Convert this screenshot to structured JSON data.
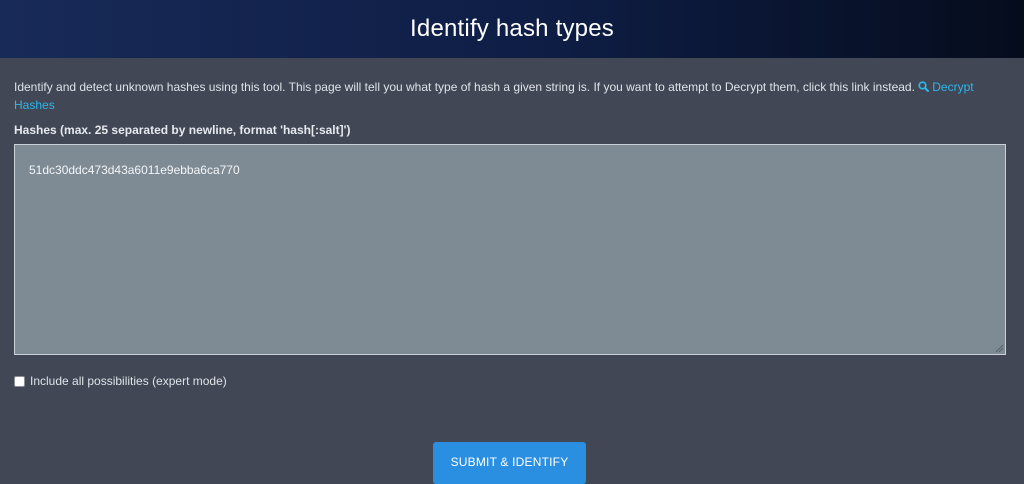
{
  "header": {
    "title": "Identify hash types"
  },
  "intro": {
    "text": "Identify and detect unknown hashes using this tool. This page will tell you what type of hash a given string is. If you want to attempt to Decrypt them, click this link instead.",
    "link_icon": "search-icon",
    "link_label": "Decrypt Hashes",
    "link_color": "#2fb6ea"
  },
  "form": {
    "hashes_label": "Hashes (max. 25 separated by newline, format 'hash[:salt]')",
    "hashes_value": "51dc30ddc473d43a6011e9ebba6ca770",
    "expert_mode_label": "Include all possibilities (expert mode)",
    "expert_mode_checked": false,
    "submit_label": "SUBMIT & IDENTIFY"
  }
}
